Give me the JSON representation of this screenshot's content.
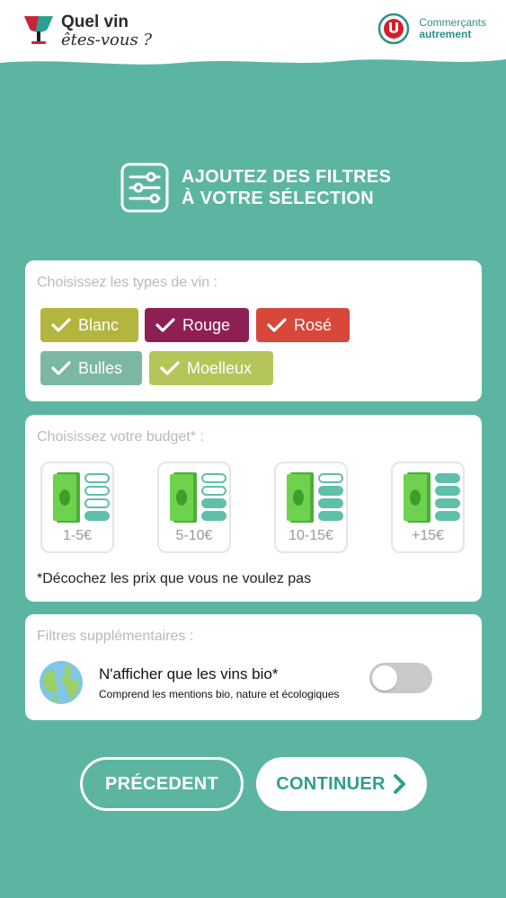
{
  "header": {
    "logo_line1": "Quel vin",
    "logo_line2": "êtes-vous ?",
    "brand_line1": "Commerçants",
    "brand_line2": "autrement"
  },
  "title": {
    "line1": "AJOUTEZ DES FILTRES",
    "line2": "À VOTRE SÉLECTION"
  },
  "wine_types": {
    "label": "Choisissez les types de vin :",
    "chips": [
      {
        "label": "Blanc",
        "color": "#b3b53f",
        "checked": true
      },
      {
        "label": "Rouge",
        "color": "#8e1f55",
        "checked": true
      },
      {
        "label": "Rosé",
        "color": "#d8473a",
        "checked": true
      },
      {
        "label": "Bulles",
        "color": "#7cb8a1",
        "checked": true
      },
      {
        "label": "Moelleux",
        "color": "#b6c55a",
        "checked": true
      }
    ]
  },
  "budget": {
    "label": "Choisissez votre budget* :",
    "options": [
      {
        "label": "1-5€",
        "filled_levels": 1
      },
      {
        "label": "5-10€",
        "filled_levels": 2
      },
      {
        "label": "10-15€",
        "filled_levels": 3
      },
      {
        "label": "+15€",
        "filled_levels": 4
      }
    ],
    "note": "*Décochez les prix que vous ne voulez pas"
  },
  "extra": {
    "label": "Filtres supplémentaires :",
    "bio_title": "N'afficher que les vins bio*",
    "bio_sub": "Comprend les mentions bio, nature et écologiques",
    "bio_enabled": false
  },
  "buttons": {
    "prev": "PRÉCEDENT",
    "next": "CONTINUER"
  },
  "colors": {
    "background": "#5cb5a2",
    "accent": "#2f9e89"
  }
}
